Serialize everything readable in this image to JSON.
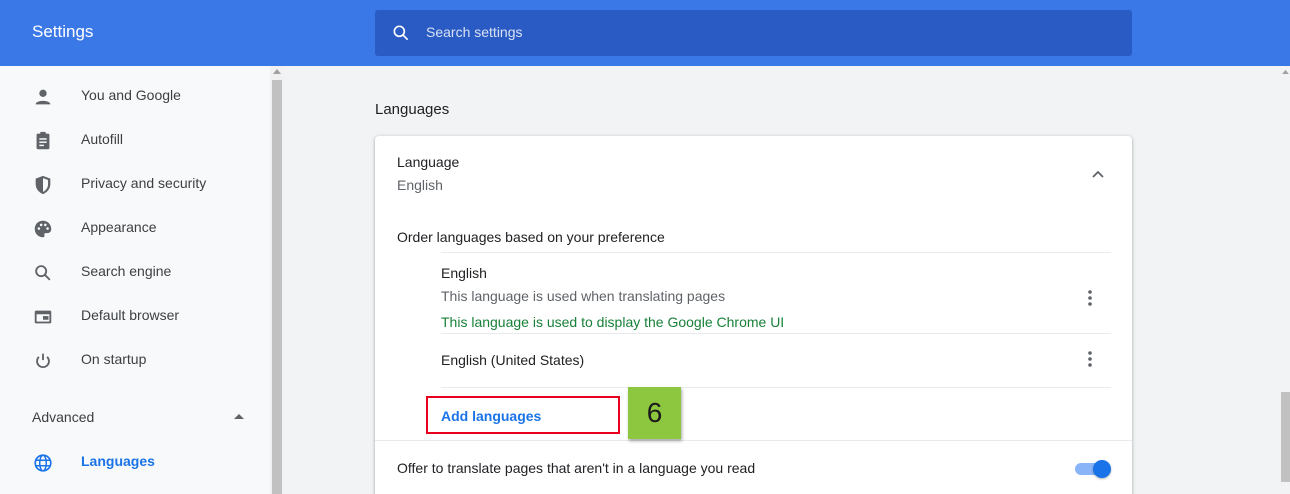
{
  "app": {
    "title": "Settings"
  },
  "search": {
    "placeholder": "Search settings"
  },
  "sidebar": {
    "items": [
      {
        "label": "You and Google",
        "icon": "person-icon",
        "active": false
      },
      {
        "label": "Autofill",
        "icon": "clipboard-icon",
        "active": false
      },
      {
        "label": "Privacy and security",
        "icon": "shield-icon",
        "active": false
      },
      {
        "label": "Appearance",
        "icon": "palette-icon",
        "active": false
      },
      {
        "label": "Search engine",
        "icon": "search-icon",
        "active": false
      },
      {
        "label": "Default browser",
        "icon": "browser-icon",
        "active": false
      },
      {
        "label": "On startup",
        "icon": "power-icon",
        "active": false
      }
    ],
    "advanced": {
      "label": "Advanced",
      "expanded": true
    },
    "advanced_items": [
      {
        "label": "Languages",
        "icon": "globe-icon",
        "active": true
      }
    ]
  },
  "main": {
    "section_title": "Languages",
    "card": {
      "language_title": "Language",
      "language_current": "English",
      "order_label": "Order languages based on your preference",
      "languages": [
        {
          "name": "English",
          "desc": "This language is used when translating pages",
          "note": "This language is used to display the Google Chrome UI"
        },
        {
          "name": "English (United States)"
        }
      ],
      "add_languages_label": "Add languages",
      "offer_translate_label": "Offer to translate pages that aren't in a language you read",
      "offer_translate_enabled": true
    }
  },
  "annotation": {
    "step_number": "6"
  },
  "colors": {
    "header_blue": "#3b78e7",
    "search_blue": "#2a5bc4",
    "accent": "#1a73e8",
    "green_text": "#188038",
    "highlight_red": "#e8001c",
    "badge_green": "#8dc63f"
  }
}
